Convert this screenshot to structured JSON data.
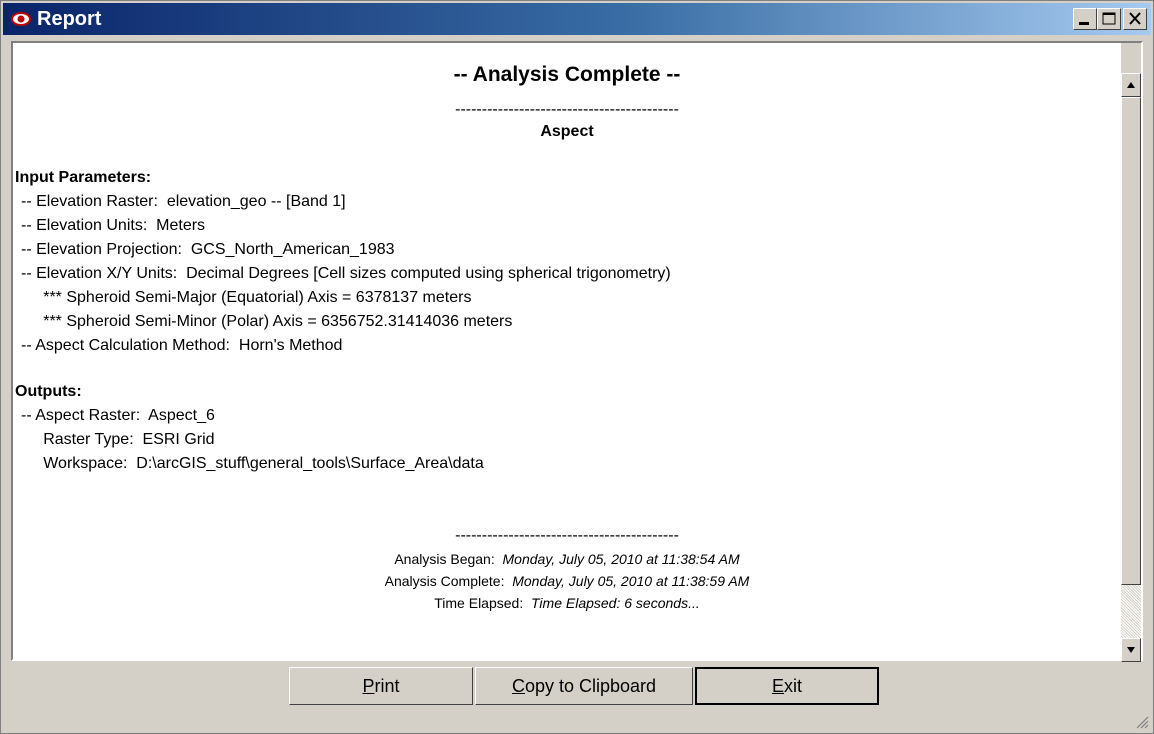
{
  "window": {
    "title": "Report"
  },
  "report": {
    "heading": "-- Analysis Complete --",
    "rule": "------------------------------------------",
    "subheading": "Aspect",
    "input_label": "Input Parameters:",
    "inputs": [
      "-- Elevation Raster:  elevation_geo -- [Band 1]",
      "-- Elevation Units:  Meters",
      "-- Elevation Projection:  GCS_North_American_1983",
      "-- Elevation X/Y Units:  Decimal Degrees [Cell sizes computed using spherical trigonometry)",
      "     *** Spheroid Semi-Major (Equatorial) Axis = 6378137 meters",
      "     *** Spheroid Semi-Minor (Polar) Axis = 6356752.31414036 meters",
      "-- Aspect Calculation Method:  Horn's Method"
    ],
    "outputs_label": "Outputs:",
    "outputs": [
      "-- Aspect Raster:  Aspect_6",
      "     Raster Type:  ESRI Grid",
      "     Workspace:  D:\\arcGIS_stuff\\general_tools\\Surface_Area\\data"
    ],
    "footer_rule": "------------------------------------------",
    "began_label": "Analysis Began:  ",
    "began_value": "Monday, July 05, 2010 at 11:38:54 AM",
    "complete_label": "Analysis Complete:  ",
    "complete_value": "Monday, July 05, 2010 at 11:38:59 AM",
    "elapsed_label": "Time Elapsed:  ",
    "elapsed_value": "Time Elapsed: 6 seconds..."
  },
  "buttons": {
    "print_accel": "P",
    "print_rest": "rint",
    "copy_accel": "C",
    "copy_rest": "opy to Clipboard",
    "exit_accel": "E",
    "exit_rest": "xit"
  }
}
